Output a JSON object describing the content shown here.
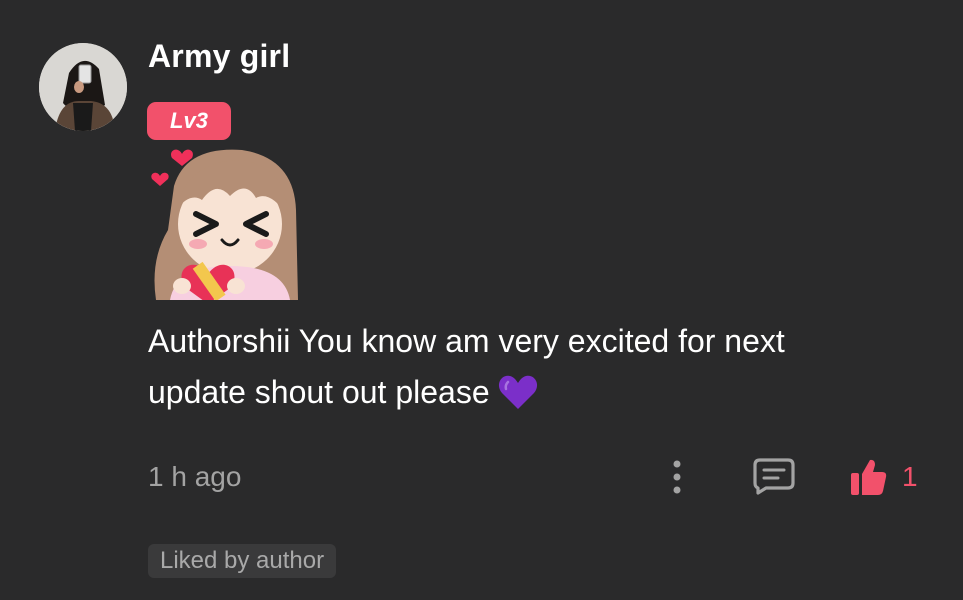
{
  "comment": {
    "author": {
      "name": "Army girl",
      "level_badge": "Lv3",
      "avatar_icon": "user-photo-avatar"
    },
    "sticker_icon": "anime-girl-holding-heart-sticker",
    "text": "Authorshii You know am very excited for next update shout out please",
    "emoji_icon": "purple-heart-emoji",
    "timestamp": "1 h ago",
    "actions": {
      "more_icon": "vertical-ellipsis-icon",
      "reply_icon": "comment-bubble-icon",
      "like_icon": "thumbs-up-icon",
      "like_count": "1"
    },
    "liked_by_author_label": "Liked by author"
  },
  "colors": {
    "background": "#2a2a2b",
    "accent": "#f2516b",
    "secondary_text": "#a3a3a3",
    "chip_background": "#3a3a3b",
    "emoji_purple": "#7b2fc9"
  }
}
